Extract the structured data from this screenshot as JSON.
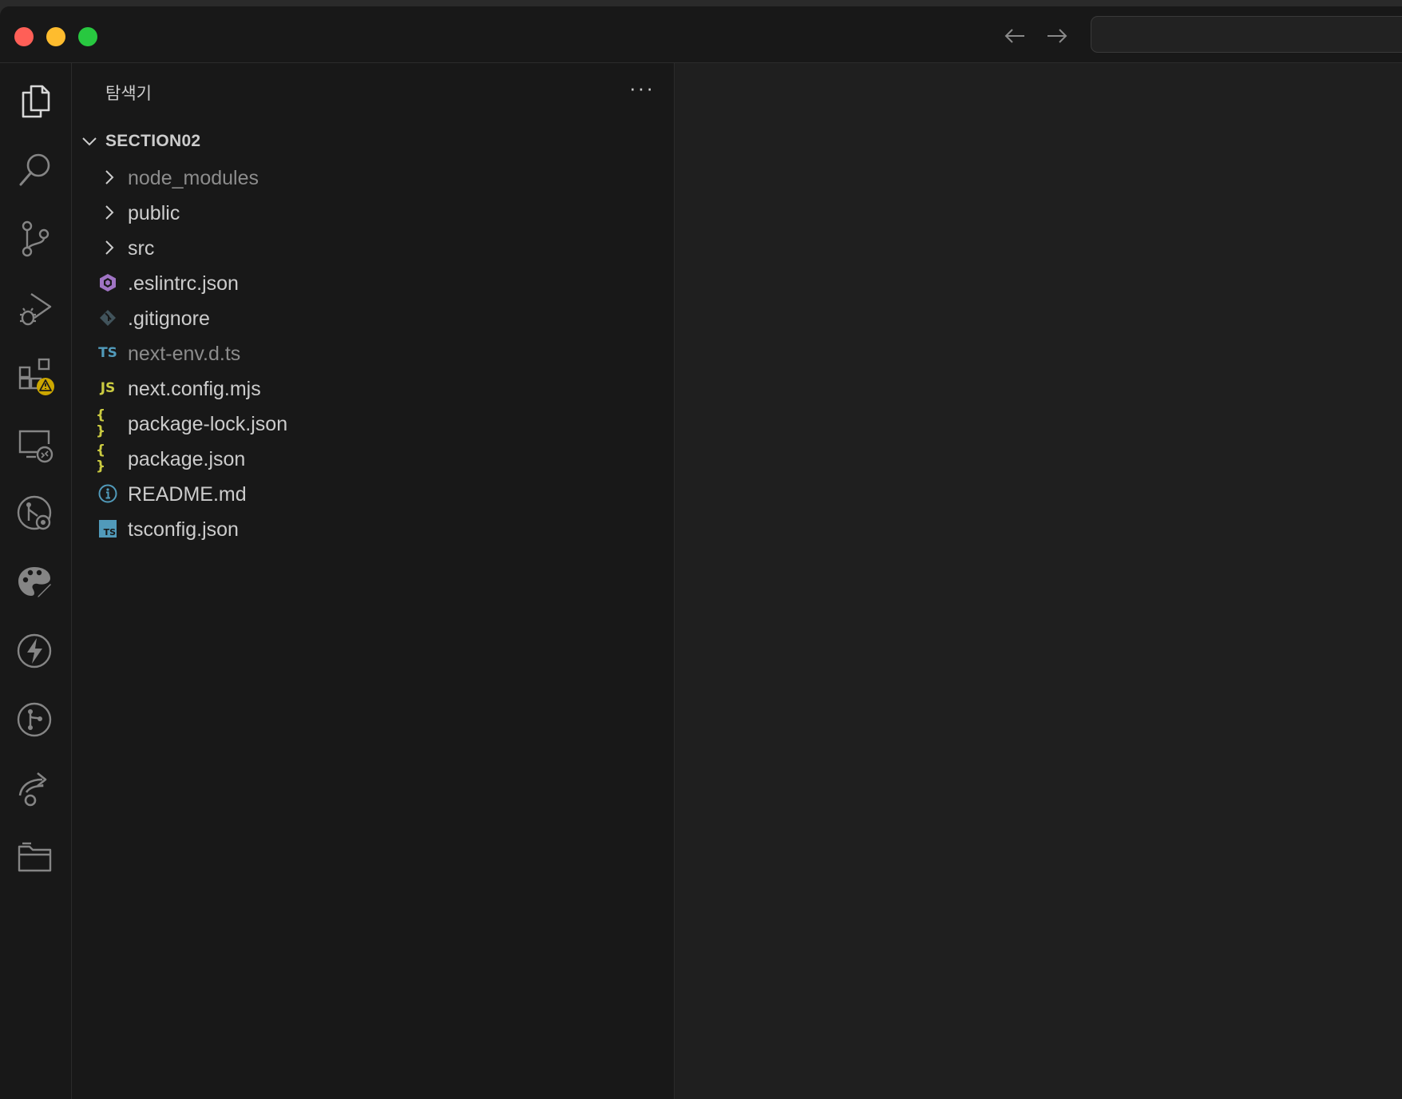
{
  "window": {
    "controls": [
      "close",
      "minimize",
      "maximize"
    ],
    "nav": {
      "back_icon": "arrow-left-icon",
      "forward_icon": "arrow-right-icon"
    },
    "command_center_text": ""
  },
  "activity_bar": {
    "items": [
      {
        "name": "explorer-icon",
        "active": true
      },
      {
        "name": "search-icon"
      },
      {
        "name": "source-control-icon"
      },
      {
        "name": "run-debug-icon"
      },
      {
        "name": "extensions-icon",
        "badge": "warning"
      },
      {
        "name": "remote-explorer-icon"
      },
      {
        "name": "git-graph-icon"
      },
      {
        "name": "themes-icon"
      },
      {
        "name": "lightning-icon"
      },
      {
        "name": "git-branch-icon"
      },
      {
        "name": "live-share-icon"
      },
      {
        "name": "project-manager-icon"
      }
    ]
  },
  "sidebar": {
    "title": "탐색기",
    "more_label": "···",
    "section": {
      "label": "SECTION02",
      "items": [
        {
          "type": "folder",
          "name": "node_modules",
          "dim": true
        },
        {
          "type": "folder",
          "name": "public"
        },
        {
          "type": "folder",
          "name": "src"
        },
        {
          "type": "file",
          "name": ".eslintrc.json",
          "icon": "eslint-icon",
          "icon_color": "#a074c4"
        },
        {
          "type": "file",
          "name": ".gitignore",
          "icon": "git-icon",
          "icon_color": "#41535b"
        },
        {
          "type": "file",
          "name": "next-env.d.ts",
          "icon": "typescript-icon",
          "icon_text": "TS",
          "icon_color": "#519aba",
          "dim": true
        },
        {
          "type": "file",
          "name": "next.config.mjs",
          "icon": "javascript-icon",
          "icon_text": "JS",
          "icon_color": "#cbcb41"
        },
        {
          "type": "file",
          "name": "package-lock.json",
          "icon": "json-icon",
          "icon_text": "{ }",
          "icon_color": "#cbcb41"
        },
        {
          "type": "file",
          "name": "package.json",
          "icon": "json-icon",
          "icon_text": "{ }",
          "icon_color": "#cbcb41"
        },
        {
          "type": "file",
          "name": "README.md",
          "icon": "info-icon",
          "icon_color": "#519aba"
        },
        {
          "type": "file",
          "name": "tsconfig.json",
          "icon": "tsconfig-icon",
          "icon_text": "TS",
          "icon_color": "#519aba"
        }
      ]
    }
  },
  "colors": {
    "titlebar_bg": "#181818",
    "sidebar_bg": "#181818",
    "editor_bg": "#1f1f1f",
    "text": "#cccccc",
    "warning_badge": "#cca700"
  }
}
